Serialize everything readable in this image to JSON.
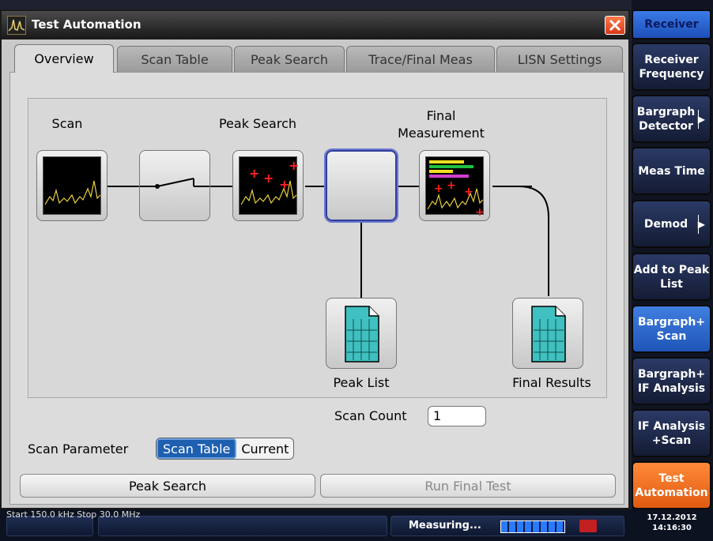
{
  "dialog": {
    "title": "Test Automation",
    "close_icon": "close-icon",
    "tabs": [
      "Overview",
      "Scan Table",
      "Peak Search",
      "Trace/Final Meas",
      "LISN Settings"
    ],
    "active_tab": "Overview"
  },
  "overview": {
    "labels": {
      "scan": "Scan",
      "peak_search": "Peak Search",
      "final_measurement_line1": "Final",
      "final_measurement_line2": "Measurement",
      "peak_list": "Peak List",
      "final_results": "Final Results"
    }
  },
  "controls": {
    "scan_count_label": "Scan Count",
    "scan_count_value": "1",
    "scan_parameter_label": "Scan Parameter",
    "scan_parameter_options": [
      "Scan Table",
      "Current"
    ],
    "scan_parameter_selected": "Scan Table",
    "peak_search_button": "Peak Search",
    "run_final_test_button": "Run Final Test"
  },
  "softkeys": {
    "header": "Receiver",
    "items": [
      {
        "label": "Receiver Frequency"
      },
      {
        "label": "Bargraph Detector"
      },
      {
        "label": "Meas Time"
      },
      {
        "label": "Demod"
      },
      {
        "label": "Add to Peak List"
      },
      {
        "label": "Bargraph+ Scan"
      },
      {
        "label": "Bargraph+ IF Analysis"
      },
      {
        "label": "IF Analysis +Scan"
      },
      {
        "label": "Test Automation"
      }
    ]
  },
  "statusbar": {
    "freq_strip": "Start 150.0 kHz                                                                                                    Stop 30.0 MHz",
    "status": "Measuring...",
    "date": "17.12.2012",
    "time": "14:16:30"
  },
  "colors": {
    "accent_blue": "#1e5fb0",
    "orange": "#e05a10",
    "selected_node": "#2f3d9a"
  }
}
